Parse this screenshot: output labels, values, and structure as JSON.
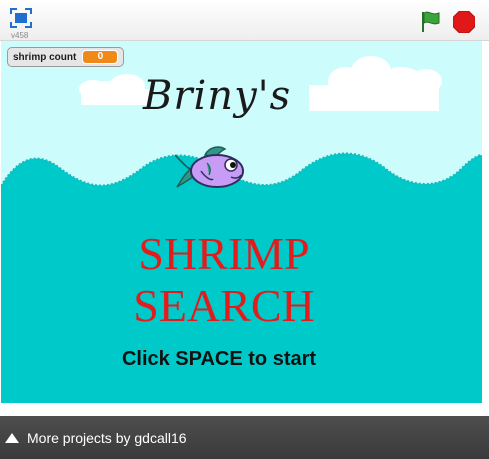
{
  "toolbar": {
    "version": "v458",
    "icons": {
      "fullscreen": "fullscreen-icon",
      "green_flag": "green-flag-icon",
      "stop": "stop-sign-icon"
    }
  },
  "stage": {
    "variable_monitor": {
      "label": "shrimp count",
      "value": "0"
    },
    "title": "Briny's",
    "headline_line1": "SHRIMP",
    "headline_line2": "SEARCH",
    "start_hint": "Click SPACE to start",
    "colors": {
      "sky": "#cdfcfd",
      "water": "#00c9c9",
      "headline": "#e21c1c",
      "fish_body": "#c79cf5",
      "fish_fin": "#2f9688"
    }
  },
  "footer": {
    "more_projects_label": "More projects by gdcall16"
  }
}
